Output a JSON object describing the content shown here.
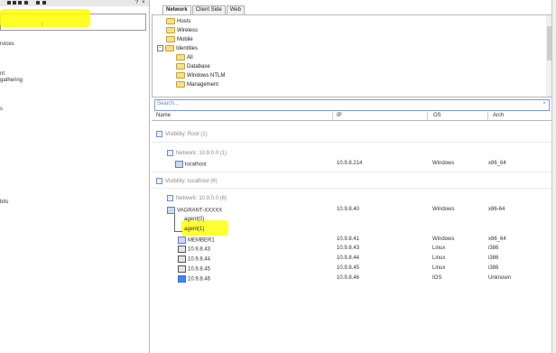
{
  "left_panel": {
    "close": "?",
    "close_x": "×",
    "items": [
      "rvices",
      "nt",
      "gathering",
      "s",
      "bits"
    ]
  },
  "tabs": [
    {
      "label": "Network",
      "active": true
    },
    {
      "label": "Client Side",
      "active": false
    },
    {
      "label": "Web",
      "active": false
    }
  ],
  "tree": {
    "items": [
      {
        "label": "Hosts"
      },
      {
        "label": "Wireless"
      },
      {
        "label": "Mobile"
      },
      {
        "label": "Identities",
        "expander": "−"
      },
      {
        "label": "All"
      },
      {
        "label": "Database"
      },
      {
        "label": "Windows NTLM"
      },
      {
        "label": "Management"
      }
    ]
  },
  "search": {
    "placeholder": "Search...",
    "clear": "×"
  },
  "columns": {
    "name": "Name",
    "ip": "IP",
    "os": "OS",
    "arch": "Arch"
  },
  "groups": [
    {
      "label": "Visibility: Root (1)"
    },
    {
      "label": "Network: 10.9.0.0 (1)"
    },
    {
      "label": "Visibility: localhost (6)"
    },
    {
      "label": "Network: 10.9.0.0 (6)"
    }
  ],
  "rows": [
    {
      "name": "localhost",
      "ip": "10.9.8.214",
      "os": "Windows",
      "arch": "x86_64",
      "icon": "windows"
    },
    {
      "name": "VAGRANT-XXXXX",
      "ip": "10.9.8.40",
      "os": "Windows",
      "arch": "x86-64",
      "icon": "windows"
    },
    {
      "name": "agent(0)",
      "ip": "",
      "os": "",
      "arch": "",
      "icon": "agent"
    },
    {
      "name": "agent(1)",
      "ip": "",
      "os": "",
      "arch": "",
      "icon": "agent"
    },
    {
      "name": "MEMBER1",
      "ip": "10.9.8.41",
      "os": "Windows",
      "arch": "x86_64",
      "icon": "windows"
    },
    {
      "name": "10.9.8.43",
      "ip": "10.9.8.43",
      "os": "Linux",
      "arch": "i386",
      "icon": "linux"
    },
    {
      "name": "10.9.8.44",
      "ip": "10.9.8.44",
      "os": "Linux",
      "arch": "i386",
      "icon": "linux"
    },
    {
      "name": "10.9.8.45",
      "ip": "10.9.8.45",
      "os": "Linux",
      "arch": "i386",
      "icon": "linux"
    },
    {
      "name": "10.9.8.46",
      "ip": "10.9.8.46",
      "os": "IOS",
      "arch": "Unknown",
      "icon": "ios"
    }
  ],
  "colors": {
    "highlight": "#ffff00",
    "accent": "#6e8fd8"
  }
}
